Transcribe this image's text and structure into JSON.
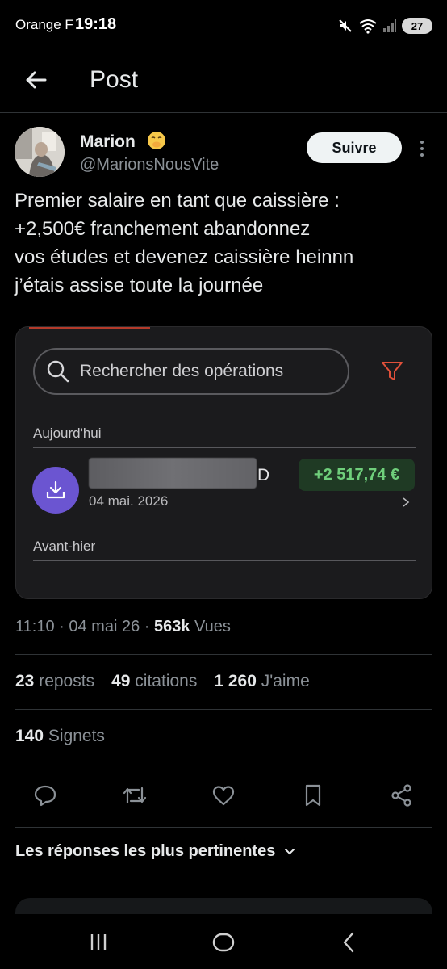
{
  "status_bar": {
    "carrier": "Orange F",
    "time": "19:18",
    "battery": "27",
    "icons": [
      "mute-icon",
      "wifi-icon",
      "signal-icon",
      "battery-icon"
    ]
  },
  "header": {
    "back_icon": "arrow-left-icon",
    "title": "Post"
  },
  "author": {
    "name": "Marion",
    "emoji": "face-with-hand-over-mouth",
    "handle": "@MarionsNousVite",
    "follow_label": "Suivre",
    "more_icon": "more-vertical-icon"
  },
  "post": {
    "text": "Premier salaire en tant que caissière :\n+2,500€ franchement abandonnez\nvos études et devenez caissière heinnn\nj’étais assise toute la journée"
  },
  "media": {
    "search_placeholder": "Rechercher des opérations",
    "section_today": "Aujourd'hui",
    "transaction": {
      "name_suffix": "D",
      "date": "04 mai. 2026",
      "amount": "+2 517,74 €"
    },
    "section_before_yesterday": "Avant-hier",
    "accent_color": "#6b55d1",
    "amount_color": "#6fcf7b"
  },
  "meta": {
    "time": "11:10",
    "date": "04 mai 26",
    "views_count": "563k",
    "views_label": "Vues"
  },
  "stats": {
    "reposts_count": "23",
    "reposts_label": "reposts",
    "quotes_count": "49",
    "quotes_label": "citations",
    "likes_count": "1 260",
    "likes_label": "J'aime",
    "bookmarks_count": "140",
    "bookmarks_label": "Signets"
  },
  "actions": [
    "reply-icon",
    "repost-icon",
    "like-icon",
    "bookmark-icon",
    "share-icon"
  ],
  "replies": {
    "sort_label": "Les réponses les plus pertinentes"
  },
  "navbar": [
    "recents-icon",
    "home-icon",
    "back-icon"
  ]
}
